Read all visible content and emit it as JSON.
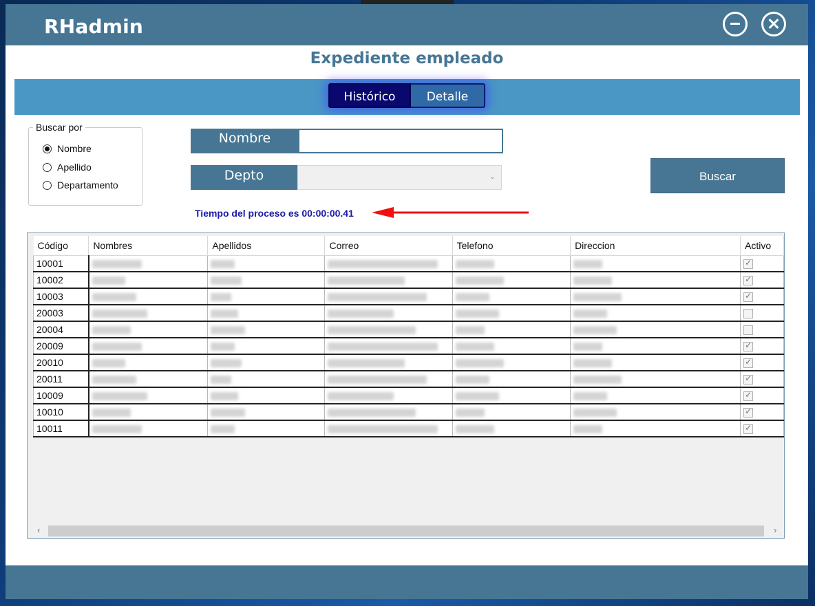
{
  "app": {
    "title": "RHadmin"
  },
  "page": {
    "title": "Expediente empleado"
  },
  "tabs": {
    "historico": "Histórico",
    "detalle": "Detalle"
  },
  "search_by": {
    "label": "Buscar por",
    "options": [
      "Nombre",
      "Apellido",
      "Departamento"
    ],
    "selected": "Nombre"
  },
  "form": {
    "nombre_label": "Nombre",
    "nombre_value": "",
    "depto_label": "Depto",
    "depto_value": "",
    "buscar_label": "Buscar"
  },
  "status": {
    "text": "Tiempo del proceso es 00:00:00.41"
  },
  "table": {
    "headers": [
      "Código",
      "Nombres",
      "Apellidos",
      "Correo",
      "Telefono",
      "Direccion",
      "Activo"
    ],
    "rows": [
      {
        "codigo": "10001",
        "activo": true
      },
      {
        "codigo": "10002",
        "activo": true
      },
      {
        "codigo": "10003",
        "activo": true
      },
      {
        "codigo": "20003",
        "activo": false
      },
      {
        "codigo": "20004",
        "activo": false
      },
      {
        "codigo": "20009",
        "activo": true
      },
      {
        "codigo": "20010",
        "activo": true
      },
      {
        "codigo": "20011",
        "activo": true
      },
      {
        "codigo": "10009",
        "activo": true
      },
      {
        "codigo": "10010",
        "activo": true
      },
      {
        "codigo": "10011",
        "activo": true
      }
    ]
  },
  "colors": {
    "primary": "#467694",
    "band": "#4a97c6",
    "status_text": "#1a1aa8",
    "arrow": "#ee1111"
  }
}
